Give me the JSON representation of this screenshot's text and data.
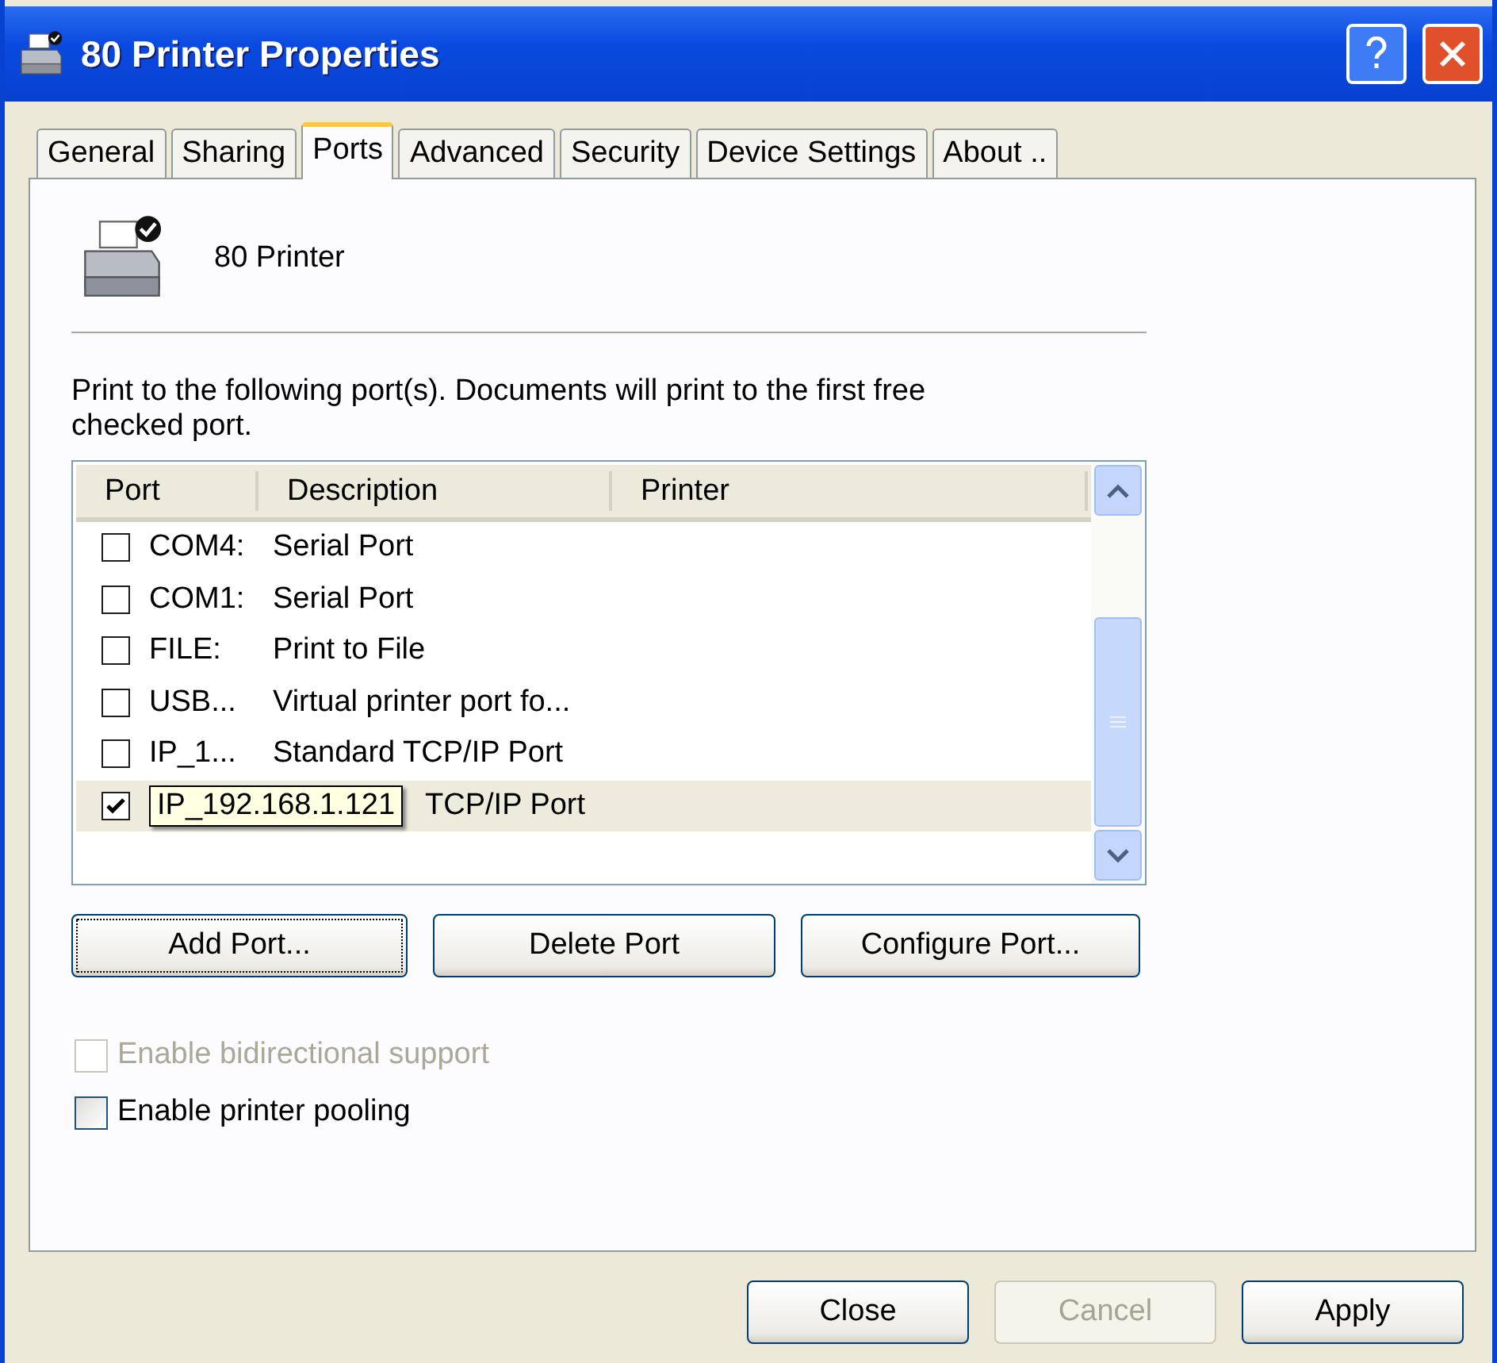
{
  "window": {
    "title": "80 Printer Properties"
  },
  "tabs": [
    {
      "label": "General",
      "selected": false
    },
    {
      "label": "Sharing",
      "selected": false
    },
    {
      "label": "Ports",
      "selected": true
    },
    {
      "label": "Advanced",
      "selected": false
    },
    {
      "label": "Security",
      "selected": false
    },
    {
      "label": "Device Settings",
      "selected": false
    },
    {
      "label": "About ..",
      "selected": false
    }
  ],
  "printer_name": "80 Printer",
  "instructions": "Print to the following port(s). Documents will print to the first free checked port.",
  "port_list": {
    "columns": [
      "Port",
      "Description",
      "Printer"
    ],
    "rows": [
      {
        "port": "COM4:",
        "description": "Serial Port",
        "checked": false,
        "selected": false
      },
      {
        "port": "COM1:",
        "description": "Serial Port",
        "checked": false,
        "selected": false
      },
      {
        "port": "FILE:",
        "description": "Print to File",
        "checked": false,
        "selected": false
      },
      {
        "port": "USB...",
        "description": "Virtual printer port fo...",
        "checked": false,
        "selected": false
      },
      {
        "port": "IP_1...",
        "description": "Standard TCP/IP Port",
        "checked": false,
        "selected": false
      },
      {
        "tooltip": "IP_192.168.1.121",
        "description": "TCP/IP Port",
        "checked": true,
        "selected": true
      }
    ]
  },
  "port_buttons": [
    {
      "label": "Add Port...",
      "focused": true
    },
    {
      "label": "Delete Port",
      "focused": false
    },
    {
      "label": "Configure Port...",
      "focused": false
    }
  ],
  "options": [
    {
      "label": "Enable bidirectional support",
      "checked": false,
      "disabled": true
    },
    {
      "label": "Enable printer pooling",
      "checked": false,
      "disabled": false
    }
  ],
  "dialog_buttons": [
    {
      "label": "Close",
      "disabled": false
    },
    {
      "label": "Cancel",
      "disabled": true
    },
    {
      "label": "Apply",
      "disabled": false
    }
  ]
}
